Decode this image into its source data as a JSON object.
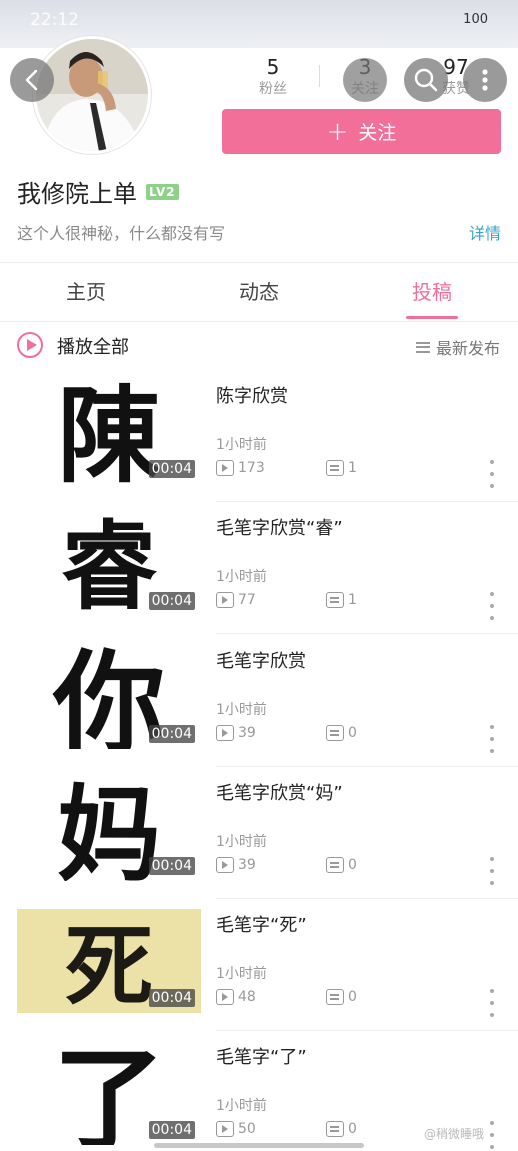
{
  "status_bar": {
    "time": "22:12",
    "battery": "100"
  },
  "profile": {
    "username": "我修院上单",
    "level": "LV2",
    "bio": "这个人很神秘，什么都没有写",
    "detail_label": "详情",
    "follow_label": "关注",
    "stats": [
      {
        "num": "5",
        "label": "粉丝"
      },
      {
        "num": "3",
        "label": "关注"
      },
      {
        "num": "97",
        "label": "获赞"
      }
    ]
  },
  "tabs": [
    {
      "label": "主页",
      "active": false
    },
    {
      "label": "动态",
      "active": false
    },
    {
      "label": "投稿",
      "active": true
    }
  ],
  "playall": {
    "label": "播放全部",
    "sort_label": "最新发布"
  },
  "videos": [
    {
      "title": "陈字欣赏",
      "time": "1小时前",
      "plays": "173",
      "comments": "1",
      "duration": "00:04",
      "glyph": "陳"
    },
    {
      "title": "毛笔字欣赏“睿”",
      "time": "1小时前",
      "plays": "77",
      "comments": "1",
      "duration": "00:04",
      "glyph": "睿"
    },
    {
      "title": "毛笔字欣赏",
      "time": "1小时前",
      "plays": "39",
      "comments": "0",
      "duration": "00:04",
      "glyph": "你"
    },
    {
      "title": "毛笔字欣赏“妈”",
      "time": "1小时前",
      "plays": "39",
      "comments": "0",
      "duration": "00:04",
      "glyph": "妈"
    },
    {
      "title": "毛笔字“死”",
      "time": "1小时前",
      "plays": "48",
      "comments": "0",
      "duration": "00:04",
      "glyph": "死"
    },
    {
      "title": "毛笔字“了”",
      "time": "1小时前",
      "plays": "50",
      "comments": "0",
      "duration": "00:04",
      "glyph": "了"
    }
  ],
  "watermark": "@稍微睡哦"
}
